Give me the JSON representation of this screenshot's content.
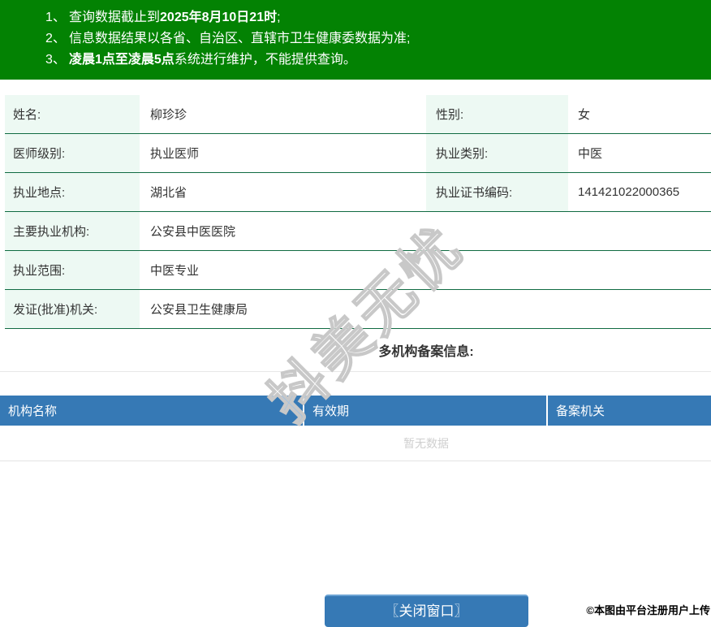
{
  "colors": {
    "notice_green": "#038203",
    "row_divider_green": "#106b42",
    "label_mint": "#edf9f3",
    "table_header_blue": "#3679b5",
    "empty_text_gray": "#cfcfcf"
  },
  "notice": {
    "lines": [
      {
        "num": "1、",
        "pre": "查询数据截止到",
        "bold": "2025年8月10日21时",
        "post": ";"
      },
      {
        "num": "2、",
        "pre": "信息数据结果以各省、自治区、直辖市卫生健康委数据为准;",
        "bold": "",
        "post": ""
      },
      {
        "num": "3、",
        "pre": "",
        "bold": "凌晨1点至凌晨5点",
        "post": "系统进行维护，不能提供查询。"
      }
    ]
  },
  "doctor_info": {
    "rows": [
      {
        "label1": "姓名:",
        "value1": "柳珍珍",
        "label2": "性别:",
        "value2": "女"
      },
      {
        "label1": "医师级别:",
        "value1": "执业医师",
        "label2": "执业类别:",
        "value2": "中医"
      },
      {
        "label1": "执业地点:",
        "value1": "湖北省",
        "label2": "执业证书编码:",
        "value2": "141421022000365"
      },
      {
        "label1": "主要执业机构:",
        "value1": "公安县中医医院"
      },
      {
        "label1": "执业范围:",
        "value1": "中医专业"
      },
      {
        "label1": "发证(批准)机关:",
        "value1": "公安县卫生健康局"
      }
    ]
  },
  "filing_section": {
    "title": "多机构备案信息:",
    "columns": [
      "机构名称",
      "有效期",
      "备案机关"
    ],
    "empty_text": "暂无数据"
  },
  "watermark": {
    "text": "抖美无忧"
  },
  "footer": {
    "close_button": "〖关闭窗口〗",
    "copyright": "©本图由平台注册用户上传"
  }
}
